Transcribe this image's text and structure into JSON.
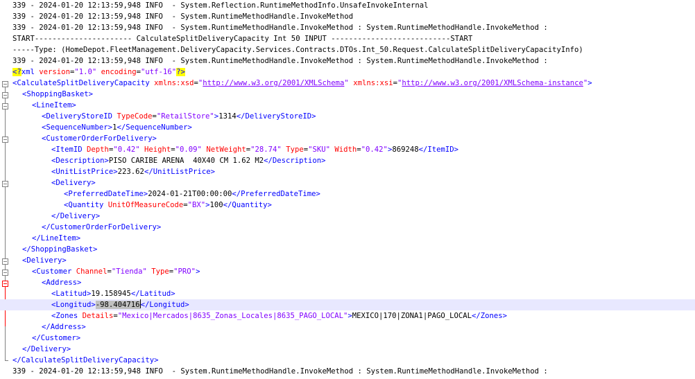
{
  "log": {
    "line1": "339 - 2024-01-20 12:13:59,948 INFO  - System.Reflection.RuntimeMethodInfo.UnsafeInvokeInternal",
    "line2": "339 - 2024-01-20 12:13:59,948 INFO  - System.RuntimeMethodHandle.InvokeMethod",
    "line3": "339 - 2024-01-20 12:13:59,948 INFO  - System.RuntimeMethodHandle.InvokeMethod : System.RuntimeMethodHandle.InvokeMethod :",
    "line4": "START---------------------- CalculateSplitDeliveryCapacity Int 50 INPUT ---------------------------START",
    "line5": "-----Type: (HomeDepot.FleetManagement.DeliveryCapacity.Services.Contracts.DTOs.Int_50.Request.CalculateSplitDeliveryCapacityInfo)",
    "line6": "339 - 2024-01-20 12:13:59,948 INFO  - System.RuntimeMethodHandle.InvokeMethod : System.RuntimeMethodHandle.InvokeMethod :",
    "line_last": "339 - 2024-01-20 12:13:59,948 INFO  - System.RuntimeMethodHandle.InvokeMethod : System.RuntimeMethodHandle.InvokeMethod :"
  },
  "xml": {
    "decl": {
      "open": "<?",
      "name": "xml",
      "a1": "version",
      "v1": "\"1.0\"",
      "a2": "encoding",
      "v2": "\"utf-16\"",
      "close": "?>"
    },
    "root": {
      "open": "<CalculateSplitDeliveryCapacity",
      "a1": "xmlns:xsd",
      "v1": "http://www.w3.org/2001/XMLSchema",
      "a2": "xmlns:xsi",
      "v2": "http://www.w3.org/2001/XMLSchema-instance",
      "close_tag": "</CalculateSplitDeliveryCapacity>"
    },
    "shopping_basket_open": "<ShoppingBasket>",
    "line_item_open": "<LineItem>",
    "delivery_store": {
      "open": "<DeliveryStoreID",
      "attr": "TypeCode",
      "val": "\"RetailStore\"",
      "value": "1314",
      "close": "</DeliveryStoreID>"
    },
    "sequence": {
      "open": "<SequenceNumber>",
      "value": "1",
      "close": "</SequenceNumber>"
    },
    "customer_order_open": "<CustomerOrderForDelivery>",
    "item_id": {
      "open": "<ItemID",
      "a1": "Depth",
      "v1": "\"0.42\"",
      "a2": "Height",
      "v2": "\"0.09\"",
      "a3": "NetWeight",
      "v3": "\"28.74\"",
      "a4": "Type",
      "v4": "\"SKU\"",
      "a5": "Width",
      "v5": "\"0.42\"",
      "value": "869248",
      "close": "</ItemID>"
    },
    "description": {
      "open": "<Description>",
      "value": "PISO CARIBE ARENA  40X40 CM 1.62 M2",
      "close": "</Description>"
    },
    "unit_price": {
      "open": "<UnitListPrice>",
      "value": "223.62",
      "close": "</UnitListPrice>"
    },
    "delivery_inner_open": "<Delivery>",
    "preferred_date": {
      "open": "<PreferredDateTime>",
      "value": "2024-01-21T00:00:00",
      "close": "</PreferredDateTime>"
    },
    "quantity": {
      "open": "<Quantity",
      "attr": "UnitOfMeasureCode",
      "val": "\"BX\"",
      "value": "100",
      "close": "</Quantity>"
    },
    "delivery_inner_close": "</Delivery>",
    "customer_order_close": "</CustomerOrderForDelivery>",
    "line_item_close": "</LineItem>",
    "shopping_basket_close": "</ShoppingBasket>",
    "delivery_open": "<Delivery>",
    "customer": {
      "open": "<Customer",
      "a1": "Channel",
      "v1": "\"Tienda\"",
      "a2": "Type",
      "v2": "\"PRO\"",
      "close": ">"
    },
    "address_open": "<Address>",
    "latitud": {
      "open": "<Latitud>",
      "value": "19.158945",
      "close": "</Latitud>"
    },
    "longitud": {
      "open": "<Longitud>",
      "value": "-98.404716",
      "close": "</Longitud>"
    },
    "zones": {
      "open": "<Zones",
      "attr": "Details",
      "val": "\"Mexico|Mercados|8635_Zonas_Locales|8635_PAGO_LOCAL\"",
      "value": "MEXICO|170|ZONA1|PAGO_LOCAL",
      "close": "</Zones>"
    },
    "address_close": "</Address>",
    "customer_close": "</Customer>",
    "delivery_close": "</Delivery>"
  }
}
